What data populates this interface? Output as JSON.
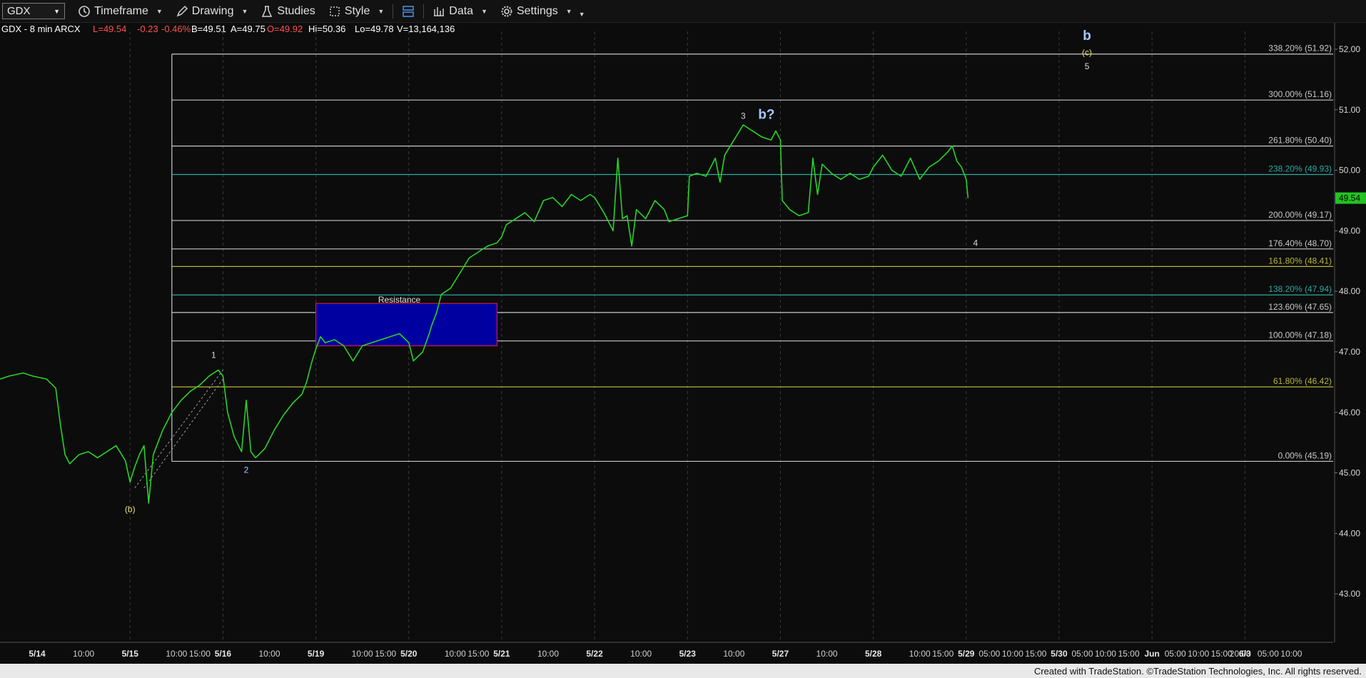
{
  "toolbar": {
    "symbol": "GDX",
    "timeframe_label": "Timeframe",
    "drawing_label": "Drawing",
    "studies_label": "Studies",
    "style_label": "Style",
    "data_label": "Data",
    "settings_label": "Settings"
  },
  "info_bar": {
    "symbol_desc": "GDX - 8 min  ARCX",
    "last": "L=49.54",
    "change": "-0.23",
    "change_pct": "-0.46%",
    "bid": "B=49.51",
    "ask": "A=49.75",
    "open": "O=49.92",
    "high": "Hi=50.36",
    "low": "Lo=49.78",
    "volume": "V=13,164,136"
  },
  "footer_text": "Created with TradeStation. ©TradeStation Technologies, Inc. All rights reserved.",
  "colors": {
    "price": "#26d426",
    "fib_gray": "#c8c8c8",
    "fib_teal": "#2fa8a0",
    "fib_olive": "#b8b43a",
    "resistance_fill": "#0000a0",
    "resistance_border": "#d01840",
    "label_blue": "#a8c8ff",
    "label_yellow": "#e8e070"
  },
  "chart_data": {
    "type": "line",
    "title": "",
    "xlabel": "",
    "ylabel": "",
    "ylim": [
      42.2,
      52.2
    ],
    "y_ticks": [
      "43.00",
      "44.00",
      "45.00",
      "46.00",
      "47.00",
      "48.00",
      "49.00",
      "50.00",
      "51.00",
      "52.00"
    ],
    "x_labels": [
      {
        "t": 0.0,
        "label": "5/14"
      },
      {
        "t": 0.5,
        "label": "10:00"
      },
      {
        "t": 1.0,
        "label": "5/15"
      },
      {
        "t": 1.5,
        "label": "10:00"
      },
      {
        "t": 1.75,
        "label": "15:00"
      },
      {
        "t": 2.0,
        "label": "5/16"
      },
      {
        "t": 2.5,
        "label": "10:00"
      },
      {
        "t": 3.0,
        "label": "5/19"
      },
      {
        "t": 3.5,
        "label": "10:00"
      },
      {
        "t": 3.75,
        "label": "15:00"
      },
      {
        "t": 4.0,
        "label": "5/20"
      },
      {
        "t": 4.5,
        "label": "10:00"
      },
      {
        "t": 4.75,
        "label": "15:00"
      },
      {
        "t": 5.0,
        "label": "5/21"
      },
      {
        "t": 5.5,
        "label": "10:00"
      },
      {
        "t": 6.0,
        "label": "5/22"
      },
      {
        "t": 6.5,
        "label": "10:00"
      },
      {
        "t": 7.0,
        "label": "5/23"
      },
      {
        "t": 7.5,
        "label": "10:00"
      },
      {
        "t": 8.0,
        "label": "5/27"
      },
      {
        "t": 8.5,
        "label": "10:00"
      },
      {
        "t": 9.0,
        "label": "5/28"
      },
      {
        "t": 9.5,
        "label": "10:00"
      },
      {
        "t": 9.75,
        "label": "15:00"
      },
      {
        "t": 10.0,
        "label": "5/29"
      },
      {
        "t": 10.25,
        "label": "05:00"
      },
      {
        "t": 10.5,
        "label": "10:00"
      },
      {
        "t": 10.75,
        "label": "15:00"
      },
      {
        "t": 11.0,
        "label": "5/30"
      },
      {
        "t": 11.25,
        "label": "05:00"
      },
      {
        "t": 11.5,
        "label": "10:00"
      },
      {
        "t": 11.75,
        "label": "15:00"
      },
      {
        "t": 12.0,
        "label": "Jun"
      },
      {
        "t": 12.25,
        "label": "05:00"
      },
      {
        "t": 12.5,
        "label": "10:00"
      },
      {
        "t": 12.75,
        "label": "15:00"
      },
      {
        "t": 12.95,
        "label": "20:00"
      },
      {
        "t": 13.0,
        "label": "6/3"
      },
      {
        "t": 13.25,
        "label": "05:00"
      },
      {
        "t": 13.5,
        "label": "10:00"
      }
    ],
    "series": [
      {
        "points": [
          [
            -0.4,
            46.55
          ],
          [
            -0.3,
            46.6
          ],
          [
            -0.15,
            46.65
          ],
          [
            -0.05,
            46.6
          ],
          [
            0.1,
            46.55
          ],
          [
            0.2,
            46.4
          ],
          [
            0.25,
            45.8
          ],
          [
            0.3,
            45.3
          ],
          [
            0.35,
            45.15
          ],
          [
            0.45,
            45.3
          ],
          [
            0.55,
            45.35
          ],
          [
            0.65,
            45.25
          ],
          [
            0.75,
            45.35
          ],
          [
            0.85,
            45.45
          ],
          [
            0.95,
            45.2
          ],
          [
            1.0,
            44.85
          ],
          [
            1.05,
            45.1
          ],
          [
            1.1,
            45.3
          ],
          [
            1.15,
            45.45
          ],
          [
            1.2,
            44.5
          ],
          [
            1.25,
            45.3
          ],
          [
            1.35,
            45.7
          ],
          [
            1.45,
            46.0
          ],
          [
            1.55,
            46.2
          ],
          [
            1.65,
            46.35
          ],
          [
            1.75,
            46.45
          ],
          [
            1.85,
            46.6
          ],
          [
            1.95,
            46.7
          ],
          [
            2.0,
            46.6
          ],
          [
            2.05,
            46.0
          ],
          [
            2.12,
            45.6
          ],
          [
            2.2,
            45.35
          ],
          [
            2.25,
            46.2
          ],
          [
            2.3,
            45.35
          ],
          [
            2.35,
            45.25
          ],
          [
            2.45,
            45.4
          ],
          [
            2.55,
            45.7
          ],
          [
            2.65,
            45.95
          ],
          [
            2.75,
            46.15
          ],
          [
            2.85,
            46.3
          ],
          [
            2.9,
            46.5
          ],
          [
            2.95,
            46.8
          ],
          [
            3.0,
            47.05
          ],
          [
            3.05,
            47.25
          ],
          [
            3.1,
            47.15
          ],
          [
            3.2,
            47.2
          ],
          [
            3.3,
            47.1
          ],
          [
            3.4,
            46.85
          ],
          [
            3.5,
            47.1
          ],
          [
            3.6,
            47.15
          ],
          [
            3.7,
            47.2
          ],
          [
            3.8,
            47.25
          ],
          [
            3.9,
            47.3
          ],
          [
            4.0,
            47.15
          ],
          [
            4.05,
            46.85
          ],
          [
            4.15,
            47.0
          ],
          [
            4.22,
            47.3
          ],
          [
            4.25,
            47.45
          ],
          [
            4.3,
            47.65
          ],
          [
            4.35,
            47.95
          ],
          [
            4.45,
            48.05
          ],
          [
            4.55,
            48.3
          ],
          [
            4.65,
            48.55
          ],
          [
            4.75,
            48.65
          ],
          [
            4.85,
            48.75
          ],
          [
            4.95,
            48.8
          ],
          [
            5.0,
            48.9
          ],
          [
            5.05,
            49.1
          ],
          [
            5.15,
            49.2
          ],
          [
            5.25,
            49.3
          ],
          [
            5.35,
            49.15
          ],
          [
            5.45,
            49.5
          ],
          [
            5.55,
            49.55
          ],
          [
            5.65,
            49.4
          ],
          [
            5.75,
            49.6
          ],
          [
            5.85,
            49.5
          ],
          [
            5.95,
            49.6
          ],
          [
            6.0,
            49.55
          ],
          [
            6.1,
            49.3
          ],
          [
            6.2,
            49.0
          ],
          [
            6.25,
            50.2
          ],
          [
            6.3,
            49.2
          ],
          [
            6.35,
            49.25
          ],
          [
            6.4,
            48.75
          ],
          [
            6.45,
            49.35
          ],
          [
            6.55,
            49.2
          ],
          [
            6.65,
            49.5
          ],
          [
            6.75,
            49.35
          ],
          [
            6.8,
            49.15
          ],
          [
            6.9,
            49.2
          ],
          [
            7.0,
            49.25
          ],
          [
            7.02,
            49.9
          ],
          [
            7.1,
            49.95
          ],
          [
            7.2,
            49.9
          ],
          [
            7.3,
            50.2
          ],
          [
            7.35,
            49.8
          ],
          [
            7.4,
            50.25
          ],
          [
            7.5,
            50.5
          ],
          [
            7.6,
            50.75
          ],
          [
            7.7,
            50.65
          ],
          [
            7.8,
            50.55
          ],
          [
            7.9,
            50.5
          ],
          [
            7.95,
            50.65
          ],
          [
            8.0,
            50.5
          ],
          [
            8.02,
            49.5
          ],
          [
            8.1,
            49.35
          ],
          [
            8.2,
            49.25
          ],
          [
            8.3,
            49.3
          ],
          [
            8.35,
            50.2
          ],
          [
            8.4,
            49.6
          ],
          [
            8.45,
            50.1
          ],
          [
            8.55,
            49.95
          ],
          [
            8.65,
            49.85
          ],
          [
            8.75,
            49.95
          ],
          [
            8.85,
            49.85
          ],
          [
            8.95,
            49.9
          ],
          [
            9.0,
            50.05
          ],
          [
            9.1,
            50.25
          ],
          [
            9.2,
            50.0
          ],
          [
            9.3,
            49.9
          ],
          [
            9.4,
            50.2
          ],
          [
            9.5,
            49.85
          ],
          [
            9.6,
            50.05
          ],
          [
            9.7,
            50.15
          ],
          [
            9.8,
            50.3
          ],
          [
            9.85,
            50.4
          ],
          [
            9.9,
            50.15
          ],
          [
            9.95,
            50.05
          ],
          [
            10.0,
            49.85
          ],
          [
            10.02,
            49.54
          ]
        ]
      }
    ],
    "fib_levels": [
      {
        "pct": "338.20%",
        "value": 51.92,
        "style": "gray"
      },
      {
        "pct": "300.00%",
        "value": 51.16,
        "style": "gray"
      },
      {
        "pct": "261.80%",
        "value": 50.4,
        "style": "gray"
      },
      {
        "pct": "238.20%",
        "value": 49.93,
        "style": "teal"
      },
      {
        "pct": "200.00%",
        "value": 49.17,
        "style": "gray"
      },
      {
        "pct": "176.40%",
        "value": 48.7,
        "style": "gray"
      },
      {
        "pct": "161.80%",
        "value": 48.41,
        "style": "olive"
      },
      {
        "pct": "138.20%",
        "value": 47.94,
        "style": "teal"
      },
      {
        "pct": "123.60%",
        "value": 47.65,
        "style": "gray"
      },
      {
        "pct": "100.00%",
        "value": 47.18,
        "style": "gray"
      },
      {
        "pct": "61.80%",
        "value": 46.42,
        "style": "olive"
      },
      {
        "pct": "0.00%",
        "value": 45.19,
        "style": "gray"
      }
    ],
    "fib_start_t": 1.45,
    "resistance_box": {
      "t1": 3.0,
      "t2": 4.95,
      "y1": 47.1,
      "y2": 47.8,
      "label": "Resistance"
    },
    "trend_lines": [
      {
        "t1": 1.05,
        "y1": 44.75,
        "t2": 2.0,
        "y2": 46.7
      },
      {
        "t1": 1.15,
        "y1": 44.75,
        "t2": 2.0,
        "y2": 46.55
      }
    ],
    "wave_labels": [
      {
        "t": 1.0,
        "y": 44.35,
        "text": "(b)",
        "color": "yellow",
        "size": "small"
      },
      {
        "t": 1.9,
        "y": 46.9,
        "text": "1",
        "color": "white",
        "size": "small"
      },
      {
        "t": 2.25,
        "y": 45.0,
        "text": "2",
        "color": "blue",
        "size": "small"
      },
      {
        "t": 7.6,
        "y": 50.85,
        "text": "3",
        "color": "white",
        "size": "small"
      },
      {
        "t": 7.85,
        "y": 50.85,
        "text": "b?",
        "color": "blue",
        "size": "large"
      },
      {
        "t": 10.1,
        "y": 48.75,
        "text": "4",
        "color": "white",
        "size": "small"
      },
      {
        "t": 11.3,
        "y": 52.15,
        "text": "b",
        "color": "blue",
        "size": "large"
      },
      {
        "t": 11.3,
        "y": 51.9,
        "text": "(c)",
        "color": "yellow",
        "size": "small"
      },
      {
        "t": 11.3,
        "y": 51.67,
        "text": "5",
        "color": "white",
        "size": "small"
      }
    ],
    "last_price": "49.54",
    "grid": false,
    "legend": "none"
  }
}
